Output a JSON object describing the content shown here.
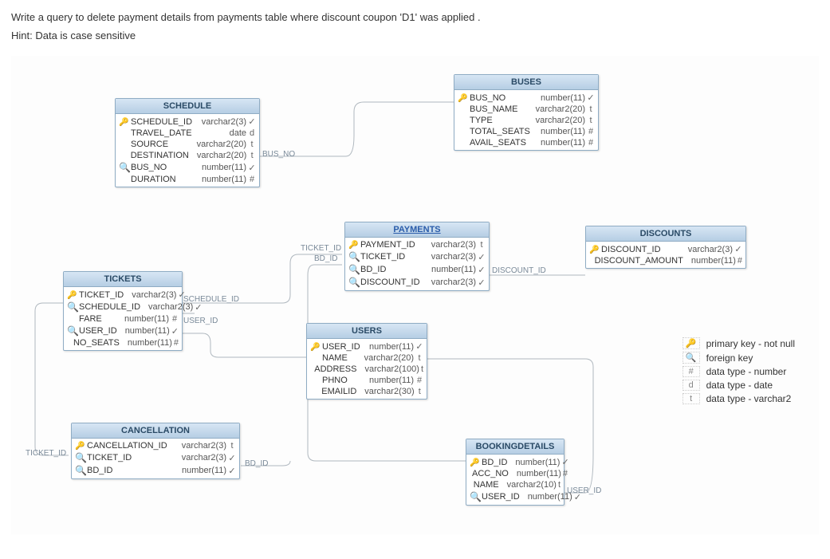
{
  "question": "Write a query to delete payment details from payments table where discount coupon 'D1' was applied .",
  "hint": "Hint: Data is case sensitive",
  "tables": {
    "schedule": {
      "title": "SCHEDULE",
      "rows": [
        {
          "icon": "pk",
          "name": "SCHEDULE_ID",
          "type": "varchar2(3)",
          "flag": "✓"
        },
        {
          "icon": "",
          "name": "TRAVEL_DATE",
          "type": "date",
          "flag": "d"
        },
        {
          "icon": "",
          "name": "SOURCE",
          "type": "varchar2(20)",
          "flag": "t"
        },
        {
          "icon": "",
          "name": "DESTINATION",
          "type": "varchar2(20)",
          "flag": "t"
        },
        {
          "icon": "fk",
          "name": "BUS_NO",
          "type": "number(11)",
          "flag": "✓"
        },
        {
          "icon": "",
          "name": "DURATION",
          "type": "number(11)",
          "flag": "#"
        }
      ]
    },
    "buses": {
      "title": "BUSES",
      "rows": [
        {
          "icon": "pk",
          "name": "BUS_NO",
          "type": "number(11)",
          "flag": "✓"
        },
        {
          "icon": "",
          "name": "BUS_NAME",
          "type": "varchar2(20)",
          "flag": "t"
        },
        {
          "icon": "",
          "name": "TYPE",
          "type": "varchar2(20)",
          "flag": "t"
        },
        {
          "icon": "",
          "name": "TOTAL_SEATS",
          "type": "number(11)",
          "flag": "#"
        },
        {
          "icon": "",
          "name": "AVAIL_SEATS",
          "type": "number(11)",
          "flag": "#"
        }
      ]
    },
    "payments": {
      "title": "PAYMENTS",
      "rows": [
        {
          "icon": "pk",
          "name": "PAYMENT_ID",
          "type": "varchar2(3)",
          "flag": "t"
        },
        {
          "icon": "fk",
          "name": "TICKET_ID",
          "type": "varchar2(3)",
          "flag": "✓"
        },
        {
          "icon": "fk",
          "name": "BD_ID",
          "type": "number(11)",
          "flag": "✓"
        },
        {
          "icon": "fk",
          "name": "DISCOUNT_ID",
          "type": "varchar2(3)",
          "flag": "✓"
        }
      ]
    },
    "discounts": {
      "title": "DISCOUNTS",
      "rows": [
        {
          "icon": "pk",
          "name": "DISCOUNT_ID",
          "type": "varchar2(3)",
          "flag": "✓"
        },
        {
          "icon": "",
          "name": "DISCOUNT_AMOUNT",
          "type": "number(11)",
          "flag": "#"
        }
      ]
    },
    "tickets": {
      "title": "TICKETS",
      "rows": [
        {
          "icon": "pk",
          "name": "TICKET_ID",
          "type": "varchar2(3)",
          "flag": "✓"
        },
        {
          "icon": "fk",
          "name": "SCHEDULE_ID",
          "type": "varchar2(3)",
          "flag": "✓"
        },
        {
          "icon": "",
          "name": "FARE",
          "type": "number(11)",
          "flag": "#"
        },
        {
          "icon": "fk",
          "name": "USER_ID",
          "type": "number(11)",
          "flag": "✓"
        },
        {
          "icon": "",
          "name": "NO_SEATS",
          "type": "number(11)",
          "flag": "#"
        }
      ]
    },
    "users": {
      "title": "USERS",
      "rows": [
        {
          "icon": "pk",
          "name": "USER_ID",
          "type": "number(11)",
          "flag": "✓"
        },
        {
          "icon": "",
          "name": "NAME",
          "type": "varchar2(20)",
          "flag": "t"
        },
        {
          "icon": "",
          "name": "ADDRESS",
          "type": "varchar2(100)",
          "flag": "t"
        },
        {
          "icon": "",
          "name": "PHNO",
          "type": "number(11)",
          "flag": "#"
        },
        {
          "icon": "",
          "name": "EMAILID",
          "type": "varchar2(30)",
          "flag": "t"
        }
      ]
    },
    "cancellation": {
      "title": "CANCELLATION",
      "rows": [
        {
          "icon": "pk",
          "name": "CANCELLATION_ID",
          "type": "varchar2(3)",
          "flag": "t"
        },
        {
          "icon": "fk",
          "name": "TICKET_ID",
          "type": "varchar2(3)",
          "flag": "✓"
        },
        {
          "icon": "fk",
          "name": "BD_ID",
          "type": "number(11)",
          "flag": "✓"
        }
      ]
    },
    "bookingdetails": {
      "title": "BOOKINGDETAILS",
      "rows": [
        {
          "icon": "pk",
          "name": "BD_ID",
          "type": "number(11)",
          "flag": "✓"
        },
        {
          "icon": "",
          "name": "ACC_NO",
          "type": "number(11)",
          "flag": "#"
        },
        {
          "icon": "",
          "name": "NAME",
          "type": "varchar2(10)",
          "flag": "t"
        },
        {
          "icon": "fk",
          "name": "USER_ID",
          "type": "number(11)",
          "flag": "✓"
        }
      ]
    }
  },
  "connectors": {
    "bus_no": "BUS_NO",
    "ticket_id_p": "TICKET_ID",
    "bd_id_p": "BD_ID",
    "discount_id": "DISCOUNT_ID",
    "schedule_id": "SCHEDULE_ID",
    "user_id_t": "USER_ID",
    "ticket_id_c": "TICKET_ID",
    "bd_id_c": "BD_ID",
    "user_id_b": "USER_ID"
  },
  "legend": {
    "pk": "primary key - not null",
    "fk": "foreign key",
    "num": "data type - number",
    "date": "data type - date",
    "varchar": "data type - varchar2"
  }
}
